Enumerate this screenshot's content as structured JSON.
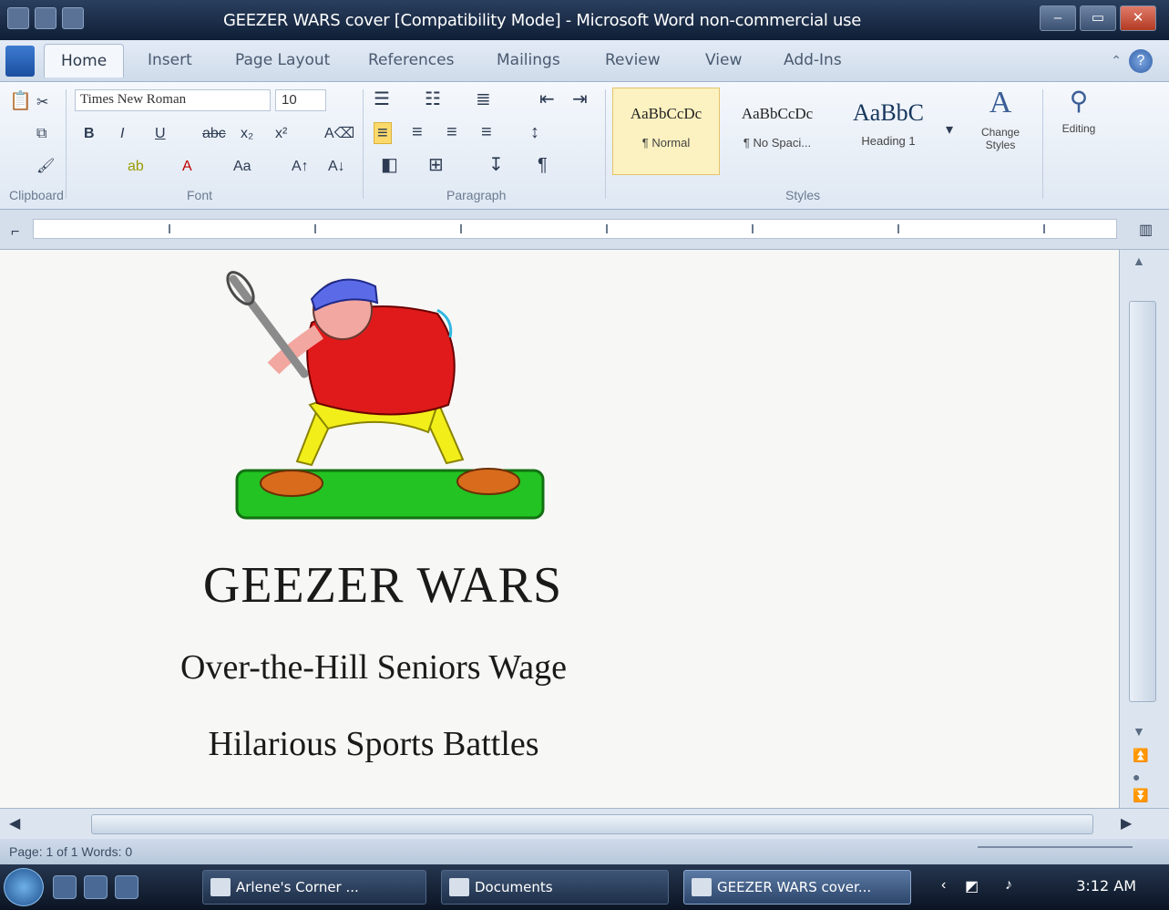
{
  "window": {
    "title": "GEEZER WARS cover [Compatibility Mode] - Microsoft Word non-commercial use",
    "controls": {
      "minimize": "–",
      "maximize": "▭",
      "close": "✕"
    }
  },
  "ribbon_tabs": [
    "Home",
    "Insert",
    "Page Layout",
    "References",
    "Mailings",
    "Review",
    "View",
    "Add-Ins"
  ],
  "ribbon": {
    "font_name": "Times New Roman",
    "font_size": "10",
    "groups": {
      "clipboard": "Clipboard",
      "font": "Font",
      "paragraph": "Paragraph",
      "styles": "Styles",
      "editing": "Editing"
    },
    "styles": [
      {
        "preview": "AaBbCcDc",
        "name": "¶ Normal"
      },
      {
        "preview": "AaBbCcDc",
        "name": "¶ No Spaci..."
      },
      {
        "preview": "AaBbC",
        "name": "Heading 1"
      }
    ],
    "change_styles": "Change Styles",
    "editing_label": "Editing"
  },
  "document": {
    "title": "GEEZER WARS",
    "subtitle_line1": "Over-the-Hill Seniors Wage",
    "subtitle_line2": "Hilarious Sports Battles",
    "clipart": "baseball-batter-clipart"
  },
  "statusbar": {
    "text": "Page: 1 of 1   Words: 0"
  },
  "taskbar": {
    "buttons": [
      {
        "label": "Arlene's Corner ...",
        "active": false
      },
      {
        "label": "Documents",
        "active": false
      },
      {
        "label": "GEEZER WARS cover...",
        "active": true
      }
    ],
    "clock": "3:12 AM"
  },
  "colors": {
    "titlebar": "#0f1e36",
    "ribbon": "#dfe8f3",
    "selected_style": "#fcf1c0",
    "taskbar": "#0b1423"
  }
}
